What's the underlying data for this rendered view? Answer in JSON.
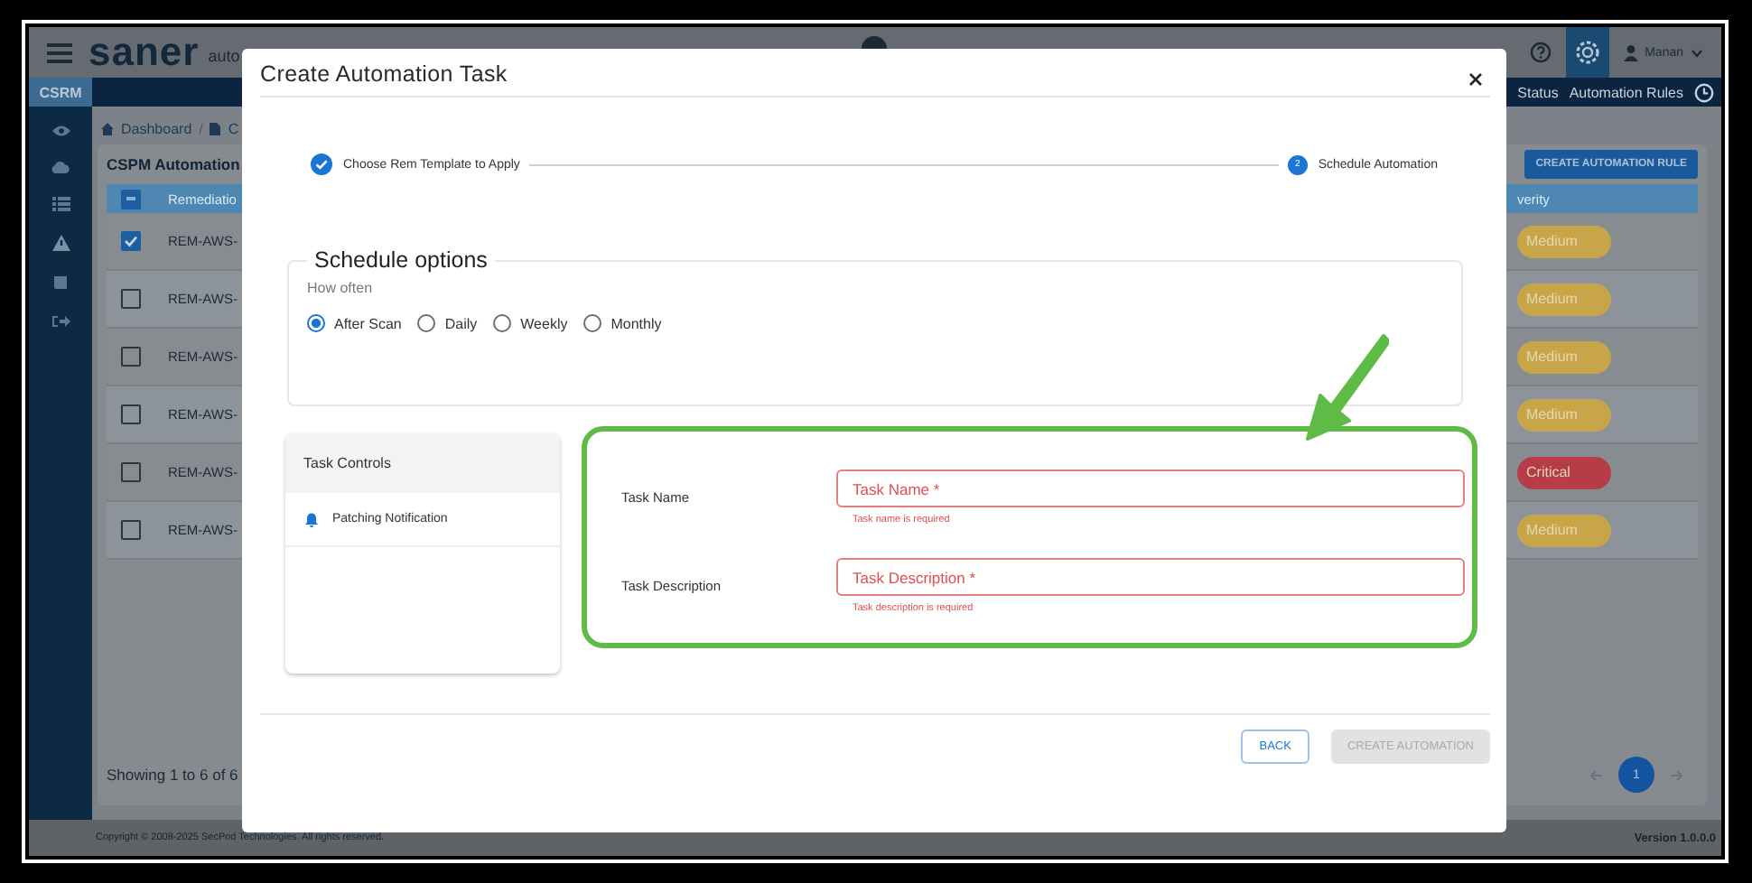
{
  "app_header": {
    "logo": "saner",
    "subtitle": "auto",
    "user": "Manan"
  },
  "nav": {
    "section": "CSRM",
    "links": [
      "Status",
      "Automation Rules"
    ]
  },
  "breadcrumb": {
    "items": [
      "Dashboard",
      "C"
    ],
    "separator": "/"
  },
  "page": {
    "title": "CSPM Automation",
    "create_button": "CREATE AUTOMATION RULE"
  },
  "table": {
    "columns": [
      "Remediatio",
      "verity"
    ],
    "header_checkbox": {
      "indeterminate": true
    },
    "rows": [
      {
        "name": "REM-AWS-",
        "checked": true,
        "severity": "Medium",
        "color": "#c9a54a"
      },
      {
        "name": "REM-AWS-",
        "checked": false,
        "severity": "Medium",
        "color": "#c9a54a"
      },
      {
        "name": "REM-AWS-",
        "checked": false,
        "severity": "Medium",
        "color": "#c9a54a"
      },
      {
        "name": "REM-AWS-",
        "checked": false,
        "severity": "Medium",
        "color": "#c9a54a"
      },
      {
        "name": "REM-AWS-",
        "checked": false,
        "severity": "Critical",
        "color": "#b63d47"
      },
      {
        "name": "REM-AWS-",
        "checked": false,
        "severity": "Medium",
        "color": "#c9a54a"
      }
    ]
  },
  "pagination": {
    "showing": "Showing 1 to 6 of 6",
    "pages": [
      {
        "label": "1",
        "selected": true
      }
    ]
  },
  "footer": {
    "copyright": "Copyright © 2008-2025 SecPod Technologies. All rights reserved.",
    "version": "Version 1.0.0.0"
  },
  "dialog": {
    "title": "Create Automation Task",
    "steps": [
      {
        "label": "Choose Rem Template to Apply",
        "completed": true
      },
      {
        "label": "Schedule Automation",
        "number": "2",
        "completed": false
      }
    ],
    "schedule": {
      "legend": "Schedule options",
      "prompt": "How often",
      "options": [
        {
          "label": "After Scan",
          "selected": true
        },
        {
          "label": "Daily",
          "selected": false
        },
        {
          "label": "Weekly",
          "selected": false
        },
        {
          "label": "Monthly",
          "selected": false
        }
      ]
    },
    "task_controls": {
      "title": "Task Controls",
      "items": [
        {
          "label": "Patching Notification"
        }
      ]
    },
    "fields": [
      {
        "label": "Task Name",
        "placeholder": "Task Name *",
        "error": "Task name is required"
      },
      {
        "label": "Task Description",
        "placeholder": "Task Description *",
        "error": "Task description is required"
      }
    ],
    "buttons": [
      {
        "label": "BACK",
        "disabled": false
      },
      {
        "label": "CREATE AUTOMATION",
        "disabled": true
      }
    ]
  }
}
